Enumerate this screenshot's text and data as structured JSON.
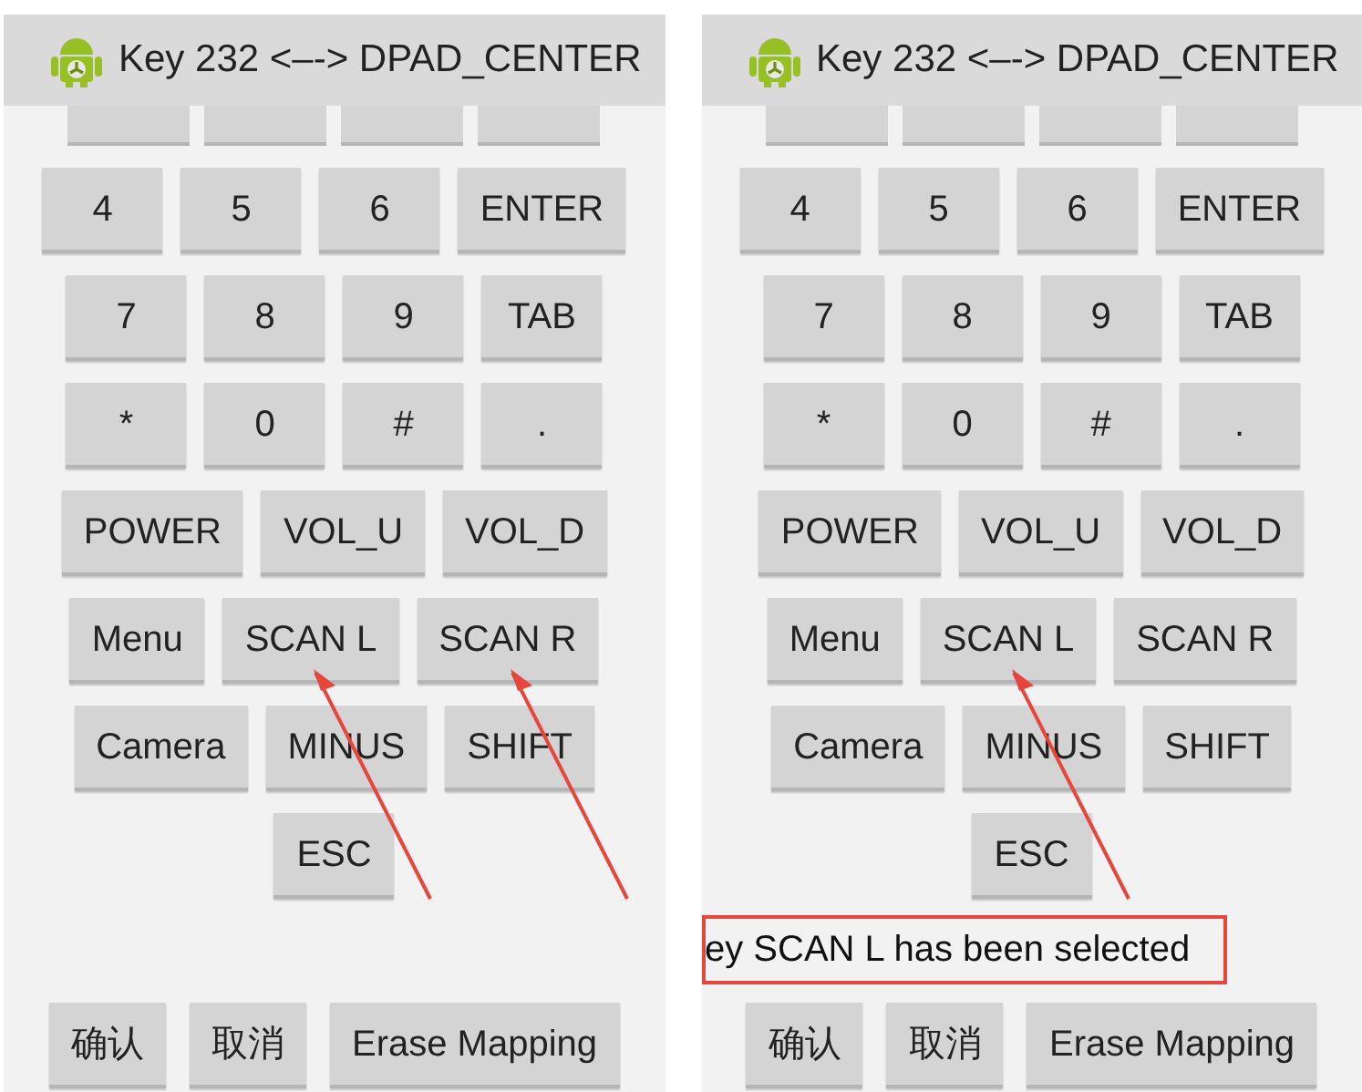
{
  "panels": [
    {
      "title": "Key 232 <–-> DPAD_CENTER",
      "key_rows": [
        [
          {
            "label": "4",
            "pointed": false
          },
          {
            "label": "5",
            "pointed": false
          },
          {
            "label": "6",
            "pointed": false
          },
          {
            "label": "ENTER",
            "pointed": false
          }
        ],
        [
          {
            "label": "7",
            "pointed": false
          },
          {
            "label": "8",
            "pointed": false
          },
          {
            "label": "9",
            "pointed": false
          },
          {
            "label": "TAB",
            "pointed": false
          }
        ],
        [
          {
            "label": "*",
            "pointed": false
          },
          {
            "label": "0",
            "pointed": false
          },
          {
            "label": "#",
            "pointed": false
          },
          {
            "label": ".",
            "pointed": false
          }
        ],
        [
          {
            "label": "POWER",
            "pointed": false
          },
          {
            "label": "VOL_U",
            "pointed": false
          },
          {
            "label": "VOL_D",
            "pointed": false
          }
        ],
        [
          {
            "label": "Menu",
            "pointed": false
          },
          {
            "label": "SCAN L",
            "pointed": true
          },
          {
            "label": "SCAN R",
            "pointed": true
          }
        ],
        [
          {
            "label": "Camera",
            "pointed": false
          },
          {
            "label": "MINUS",
            "pointed": false
          },
          {
            "label": "SHIFT",
            "pointed": false
          }
        ],
        [
          {
            "label": "ESC",
            "pointed": false
          }
        ]
      ],
      "actions": [
        "确认",
        "取消",
        "Erase Mapping"
      ]
    },
    {
      "title": "Key 232 <–-> DPAD_CENTER",
      "key_rows": [
        [
          {
            "label": "4",
            "pointed": false
          },
          {
            "label": "5",
            "pointed": false
          },
          {
            "label": "6",
            "pointed": false
          },
          {
            "label": "ENTER",
            "pointed": false
          }
        ],
        [
          {
            "label": "7",
            "pointed": false
          },
          {
            "label": "8",
            "pointed": false
          },
          {
            "label": "9",
            "pointed": false
          },
          {
            "label": "TAB",
            "pointed": false
          }
        ],
        [
          {
            "label": "*",
            "pointed": false
          },
          {
            "label": "0",
            "pointed": false
          },
          {
            "label": "#",
            "pointed": false
          },
          {
            "label": ".",
            "pointed": false
          }
        ],
        [
          {
            "label": "POWER",
            "pointed": false
          },
          {
            "label": "VOL_U",
            "pointed": false
          },
          {
            "label": "VOL_D",
            "pointed": false
          }
        ],
        [
          {
            "label": "Menu",
            "pointed": false
          },
          {
            "label": "SCAN L",
            "pointed": true
          },
          {
            "label": "SCAN R",
            "pointed": false
          }
        ],
        [
          {
            "label": "Camera",
            "pointed": false
          },
          {
            "label": "MINUS",
            "pointed": false
          },
          {
            "label": "SHIFT",
            "pointed": false
          }
        ],
        [
          {
            "label": "ESC",
            "pointed": false
          }
        ]
      ],
      "message": {
        "text": "ey SCAN L has been selected",
        "highlighted": true
      },
      "actions": [
        "确认",
        "取消",
        "Erase Mapping"
      ]
    }
  ]
}
